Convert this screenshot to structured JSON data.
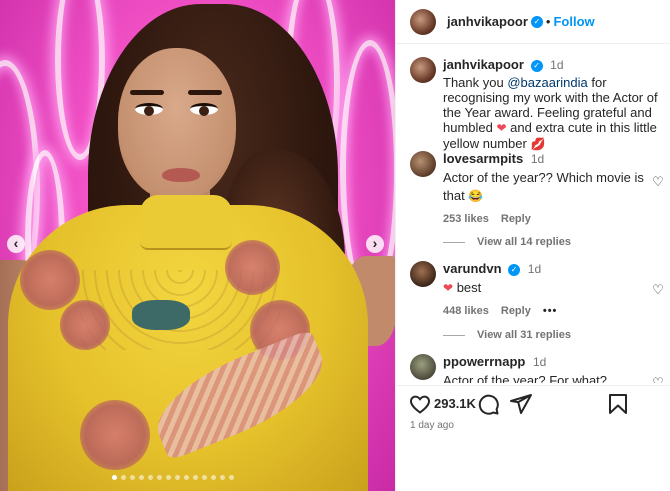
{
  "post": {
    "username": "janhvikapoor",
    "follow_label": "Follow",
    "separator": "•"
  },
  "caption": {
    "username": "janhvikapoor",
    "time": "1d",
    "text_before": "Thank you ",
    "mention": "@bazaarindia",
    "text_after": " for recognising my work with the Actor of the Year award. Feeling grateful and humbled ",
    "text_end": " and extra cute in this little yellow number "
  },
  "comments": [
    {
      "username": "lovesarmpits",
      "time": "1d",
      "text": "Actor of the year?? Which movie is that ",
      "emoji": "😂",
      "likes": "253 likes",
      "reply_label": "Reply",
      "view_replies": "View all 14 replies"
    },
    {
      "username": "varundvn",
      "time": "1d",
      "text": "best",
      "likes": "448 likes",
      "reply_label": "Reply",
      "more": "•••",
      "view_replies": "View all 31 replies"
    },
    {
      "username": "ppowerrnapp",
      "time": "1d",
      "text": "Actor of the year? For what?"
    }
  ],
  "actions": {
    "likes_count": "293.1K",
    "age": "1 day ago"
  },
  "icons": {
    "heart": "heart-icon",
    "comment": "comment-icon",
    "share": "share-icon",
    "bookmark": "bookmark-icon"
  },
  "colors": {
    "accent": "#0095f6",
    "like_red": "#ed4956",
    "background_pink": "#f04fc4",
    "dress_yellow": "#e5c12b"
  },
  "carousel": {
    "slide_count": 14,
    "active_slide": 1
  }
}
